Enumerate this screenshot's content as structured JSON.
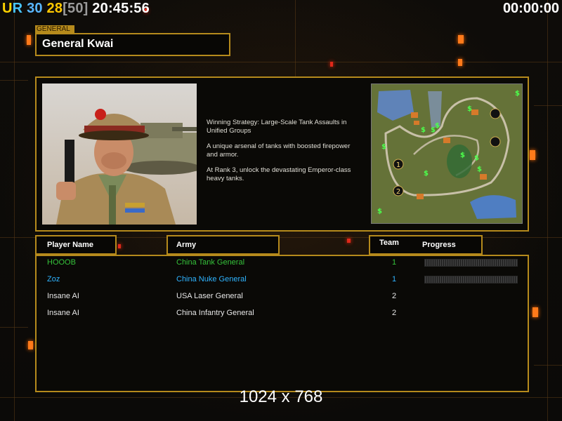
{
  "hud": {
    "rank_u": "U",
    "rank_r": "R",
    "value_a": "30",
    "value_b": "28",
    "value_c": "[50]",
    "clock": "20:45:56",
    "timer": "00:00:00"
  },
  "general": {
    "tag": "GENERAL",
    "name": "General Kwai"
  },
  "description": [
    "Winning Strategy: Large-Scale Tank Assaults in\n Unified Groups",
    "A unique arsenal of tanks with boosted firepower\n and armor.",
    "At Rank 3, unlock the devastating Emperor-class\n heavy tanks."
  ],
  "table": {
    "headers": {
      "player": "Player Name",
      "army": "Army",
      "team": "Team",
      "progress": "Progress"
    },
    "rows": [
      {
        "player": "HOOOB",
        "army": "China Tank General",
        "team": "1",
        "color": "#35c23a",
        "progress": 0
      },
      {
        "player": "Zoz",
        "army": "China Nuke General",
        "team": "1",
        "color": "#2fb4ff",
        "progress": 0
      },
      {
        "player": "Insane AI",
        "army": "USA Laser General",
        "team": "2",
        "color": "#e6e6e6"
      },
      {
        "player": "Insane AI",
        "army": "China Infantry General",
        "team": "2",
        "color": "#e6e6e6"
      }
    ]
  },
  "footer": {
    "resolution": "1024 x 768"
  },
  "minimap": {
    "start_positions": [
      "1",
      "2"
    ],
    "resource_icon": "dollar-sign-icon"
  }
}
